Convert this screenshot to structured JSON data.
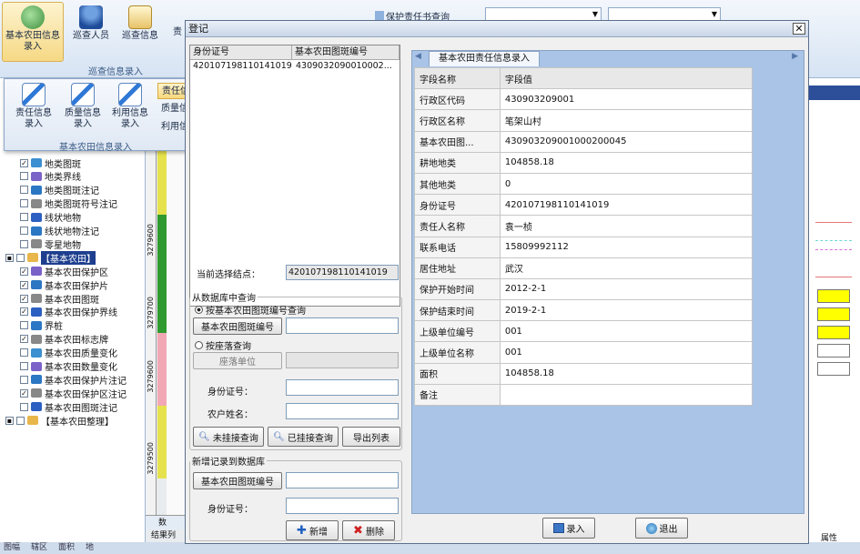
{
  "ribbon": {
    "btn_basic_entry": "基本农田信息录入",
    "btn_inspector": "巡查人员",
    "btn_inspect_info": "巡查信息",
    "btn_trunc": "责",
    "group_inspect": "巡查信息录入",
    "btn_protect_query": "保护责任书查询"
  },
  "dropdown": {
    "btn_resp": "责任信息录入",
    "btn_quality": "质量信息录入",
    "btn_use": "利用信息录入",
    "group_label": "基本农田信息录入",
    "menu": [
      "责任信息批量录入",
      "质量信息批量录入",
      "利用信息批量录入"
    ]
  },
  "tree": [
    {
      "label": "地类图斑",
      "checked": true
    },
    {
      "label": "地类界线",
      "checked": false
    },
    {
      "label": "地类图斑注记",
      "checked": false
    },
    {
      "label": "地类图斑符号注记",
      "checked": false
    },
    {
      "label": "线状地物",
      "checked": false
    },
    {
      "label": "线状地物注记",
      "checked": false
    },
    {
      "label": "零星地物",
      "checked": false
    },
    {
      "label": "【基本农田】",
      "checked": false,
      "group": true
    },
    {
      "label": "基本农田保护区",
      "checked": true
    },
    {
      "label": "基本农田保护片",
      "checked": true
    },
    {
      "label": "基本农田图斑",
      "checked": true
    },
    {
      "label": "基本农田保护界线",
      "checked": true
    },
    {
      "label": "界桩",
      "checked": false
    },
    {
      "label": "基本农田标志牌",
      "checked": true
    },
    {
      "label": "基本农田质量变化",
      "checked": false
    },
    {
      "label": "基本农田数量变化",
      "checked": false
    },
    {
      "label": "基本农田保护片注记",
      "checked": false
    },
    {
      "label": "基本农田保护区注记",
      "checked": true
    },
    {
      "label": "基本农田图斑注记",
      "checked": false
    },
    {
      "label": "【基本农田整理】",
      "checked": false,
      "group": true
    }
  ],
  "map_ruler": [
    "3279600",
    "3279700",
    "3279600",
    "3279500"
  ],
  "statusbar": [
    "图幅",
    "辖区",
    "面积",
    "地"
  ],
  "bottom_tabs": [
    "数",
    "结果列"
  ],
  "right_strip_label": "属性",
  "dialog": {
    "title": "登记",
    "grid": {
      "headers": [
        "身份证号",
        "基本农田图斑编号"
      ],
      "rows": [
        [
          "420107198110141019",
          "4309032090010002..."
        ]
      ]
    },
    "current_node_label": "当前选择结点：",
    "current_node_value": "420107198110141019",
    "db_query": {
      "legend": "从数据库中查询",
      "radio_by_code": "按基本农田图斑编号查询",
      "btn_code": "基本农田图斑编号",
      "radio_by_village": "按座落查询",
      "btn_location": "座落单位",
      "id_label": "身份证号：",
      "farmer_label": "农户姓名：",
      "btn_unmounted": "未挂接查询",
      "btn_mounted": "已挂接查询",
      "btn_export": "导出列表"
    },
    "new_record": {
      "legend": "新增记录到数据库",
      "btn_code": "基本农田图斑编号",
      "id_label": "身份证号：",
      "btn_add": "新增",
      "btn_delete": "删除"
    },
    "detail_tab": "基本农田责任信息录入",
    "detail_headers": [
      "字段名称",
      "字段值"
    ],
    "detail_rows": [
      [
        "行政区代码",
        "430903209001"
      ],
      [
        "行政区名称",
        "笔架山村"
      ],
      [
        "基本农田图...",
        "430903209001000200045"
      ],
      [
        "耕地地类",
        "104858.18"
      ],
      [
        "其他地类",
        "0"
      ],
      [
        "身份证号",
        "420107198110141019"
      ],
      [
        "责任人名称",
        "袁一桢"
      ],
      [
        "联系电话",
        "15809992112"
      ],
      [
        "居住地址",
        "武汉"
      ],
      [
        "保护开始时间",
        "2012-2-1"
      ],
      [
        "保护结束时间",
        "2019-2-1"
      ],
      [
        "上级单位编号",
        "001"
      ],
      [
        "上级单位名称",
        "001"
      ],
      [
        "面积",
        "104858.18"
      ],
      [
        "备注",
        ""
      ]
    ],
    "btn_record": "录入",
    "btn_exit": "退出"
  }
}
